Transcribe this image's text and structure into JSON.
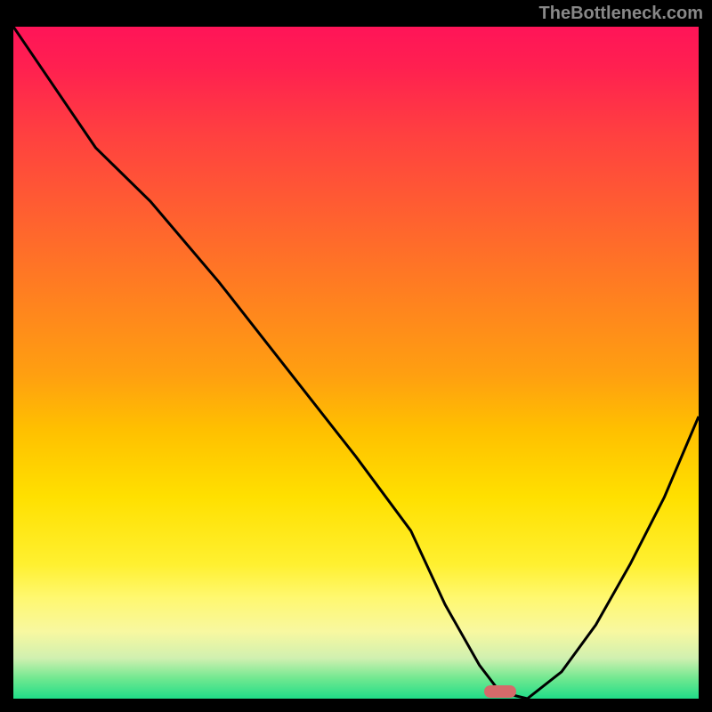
{
  "watermark": "TheBottleneck.com",
  "chart_data": {
    "type": "line",
    "title": "",
    "xlabel": "",
    "ylabel": "",
    "xlim": [
      0,
      100
    ],
    "ylim": [
      0,
      100
    ],
    "background_gradient": {
      "top_color": "#ff1458",
      "bottom_color": "#20dd88",
      "description": "vertical red-orange-yellow-green gradient"
    },
    "series": [
      {
        "name": "bottleneck-curve",
        "x": [
          0,
          12,
          20,
          30,
          40,
          50,
          58,
          63,
          68,
          71,
          75,
          80,
          85,
          90,
          95,
          100
        ],
        "values": [
          100,
          82,
          74,
          62,
          49,
          36,
          25,
          14,
          5,
          1,
          0,
          4,
          11,
          20,
          30,
          42
        ]
      }
    ],
    "marker": {
      "name": "optimal-point",
      "x": 71,
      "y": 1,
      "color": "#d56a6a"
    }
  }
}
